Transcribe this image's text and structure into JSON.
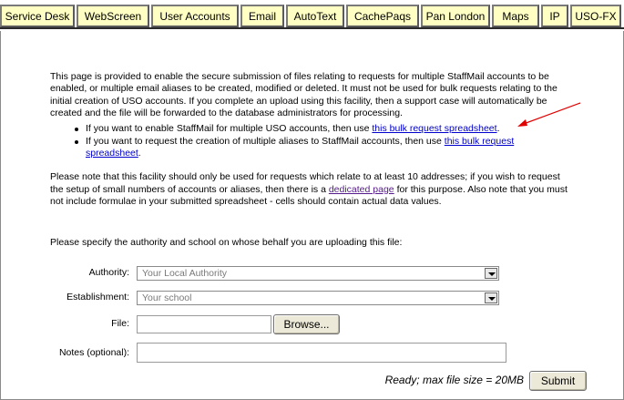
{
  "tabs": [
    {
      "label": "Service Desk"
    },
    {
      "label": "WebScreen"
    },
    {
      "label": "User Accounts"
    },
    {
      "label": "Email"
    },
    {
      "label": "AutoText"
    },
    {
      "label": "CachePaqs"
    },
    {
      "label": "Pan London"
    },
    {
      "label": "Maps"
    },
    {
      "label": "IP"
    },
    {
      "label": "USO-FX"
    }
  ],
  "intro": "This page is provided to enable the secure submission of files relating to requests for multiple StaffMail accounts to be enabled, or multiple email aliases to be created, modified or deleted. It must not be used for bulk requests relating to the initial creation of USO accounts. If you complete an upload using this facility, then a support case will automatically be created and the file will be forwarded to the database administrators for processing.",
  "bullets": [
    {
      "before": "If you want to enable StaffMail for multiple USO accounts, then use ",
      "link": "this bulk request spreadsheet",
      "after": "."
    },
    {
      "before": "If you want to request the creation of multiple aliases to StaffMail accounts, then use ",
      "link": "this bulk request spreadsheet",
      "after": "."
    }
  ],
  "note": {
    "before": "Please note that this facility should only be used for requests which relate to at least 10 addresses; if you wish to request the setup of small numbers of accounts or aliases, then there is a ",
    "link": "dedicated page",
    "after": " for this purpose. Also note that you must not include formulae in your submitted spreadsheet - cells should contain actual data values."
  },
  "specify": "Please specify the authority and school on whose behalf you are uploading this file:",
  "form": {
    "authority_label": "Authority:",
    "authority_value": "Your Local Authority",
    "establishment_label": "Establishment:",
    "establishment_value": "Your school",
    "file_label": "File:",
    "file_value": "",
    "browse_label": "Browse...",
    "notes_label": "Notes (optional):",
    "notes_value": ""
  },
  "status": "Ready; max file size = 20MB",
  "submit_label": "Submit",
  "colors": {
    "tab_bg": "#ffffc4",
    "link": "#0000cc",
    "visited_link": "#551a8b",
    "annotation_arrow": "#e00000"
  }
}
